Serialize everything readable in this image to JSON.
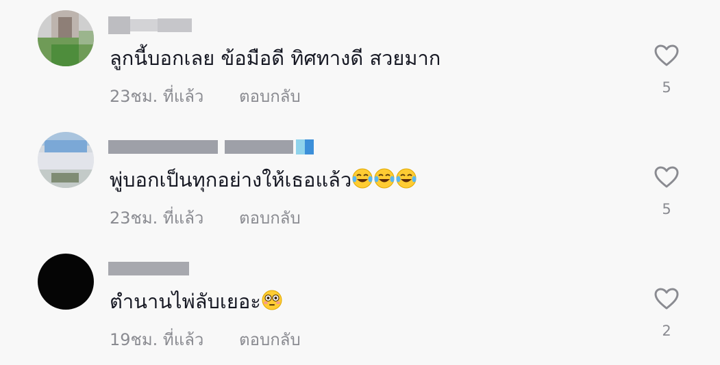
{
  "comments": [
    {
      "text": "ลูกนี้บอกเลย ข้อมือดี ทิศทางดี สวยมาก",
      "time": "23ชม. ที่แล้ว",
      "reply_label": "ตอบกลับ",
      "likes": "5",
      "avatar_colors": [
        "#dcdcdc",
        "#b9b3ae",
        "#6e9a58",
        "#4f8e3c"
      ]
    },
    {
      "text": "พู่บอกเป็นทุกอย่างให้เธอแล้ว",
      "emojis": [
        "laughing-crying-emoji",
        "laughing-crying-emoji",
        "laughing-crying-emoji"
      ],
      "time": "23ชม. ที่แล้ว",
      "reply_label": "ตอบกลับ",
      "likes": "5",
      "avatar_colors": [
        "#8bb3da",
        "#d9dbe2",
        "#cfd6dd",
        "#8c9a86"
      ]
    },
    {
      "text": "ตำนานไพ่ลับเยอะ",
      "emojis": [
        "flushed-emoji"
      ],
      "time": "19ชม. ที่แล้ว",
      "reply_label": "ตอบกลับ",
      "likes": "2",
      "avatar_colors": [
        "#050505"
      ]
    }
  ],
  "icons": {
    "like": "heart-outline-icon"
  },
  "colors": {
    "background": "#f8f8f8",
    "text": "#161823",
    "secondary": "#8a8b91"
  }
}
